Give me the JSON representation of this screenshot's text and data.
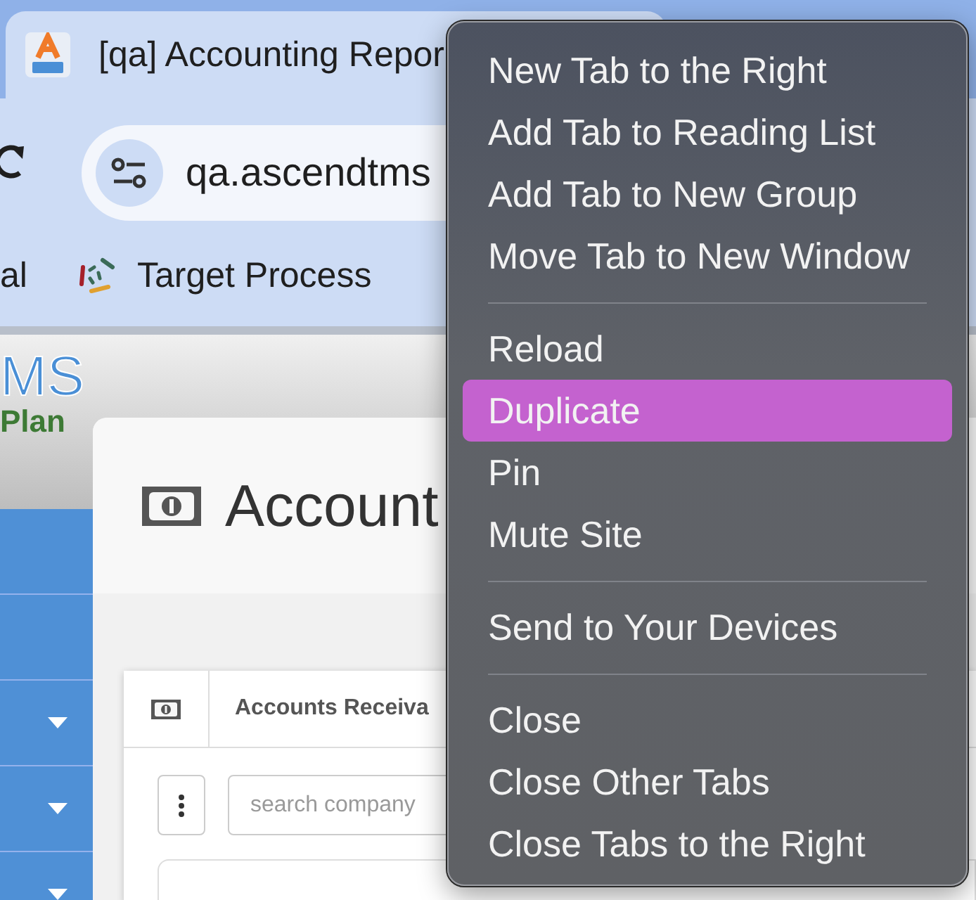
{
  "browser": {
    "tab": {
      "title": "[qa] Accounting Repor"
    },
    "address_bar": {
      "url": "qa.ascendtms"
    },
    "bookmarks": [
      {
        "label": "al",
        "kind": "text"
      },
      {
        "label": "Target Process",
        "kind": "icon"
      }
    ]
  },
  "app": {
    "logo": {
      "text": "MS",
      "subtitle": "Plan"
    },
    "sidebar": {
      "items": [
        {
          "expandable": false
        },
        {
          "expandable": false
        },
        {
          "expandable": true
        },
        {
          "expandable": true
        },
        {
          "expandable": true
        }
      ]
    },
    "page_title": "Account",
    "panel": {
      "title": "Accounts Receiva",
      "search": {
        "placeholder": "search company"
      }
    }
  },
  "context_menu": {
    "items": [
      {
        "kind": "item",
        "label": "New Tab to the Right",
        "selected": false
      },
      {
        "kind": "item",
        "label": "Add Tab to Reading List",
        "selected": false
      },
      {
        "kind": "item",
        "label": "Add Tab to New Group",
        "selected": false
      },
      {
        "kind": "item",
        "label": "Move Tab to New Window",
        "selected": false
      },
      {
        "kind": "separator"
      },
      {
        "kind": "item",
        "label": "Reload",
        "selected": false
      },
      {
        "kind": "item",
        "label": "Duplicate",
        "selected": true
      },
      {
        "kind": "item",
        "label": "Pin",
        "selected": false
      },
      {
        "kind": "item",
        "label": "Mute Site",
        "selected": false
      },
      {
        "kind": "separator"
      },
      {
        "kind": "item",
        "label": "Send to Your Devices",
        "selected": false
      },
      {
        "kind": "separator"
      },
      {
        "kind": "item",
        "label": "Close",
        "selected": false
      },
      {
        "kind": "item",
        "label": "Close Other Tabs",
        "selected": false
      },
      {
        "kind": "item",
        "label": "Close Tabs to the Right",
        "selected": false
      }
    ]
  }
}
